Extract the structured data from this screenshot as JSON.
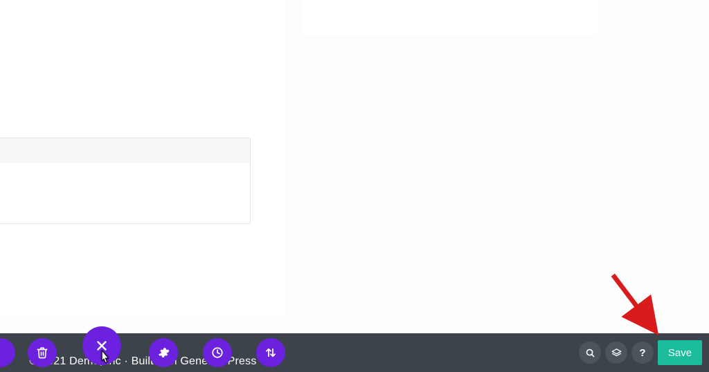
{
  "footer": {
    "text": "© 2021 Demo, Inc · Built with GeneratePress"
  },
  "toolbar": {
    "buttons": {
      "trash": "trash-icon",
      "close": "close-icon",
      "settings": "gear-icon",
      "history": "clock-icon",
      "sort": "sort-icon"
    },
    "right": {
      "search": "search-icon",
      "layers": "layers-icon",
      "help": "?"
    },
    "save_label": "Save"
  },
  "colors": {
    "accent": "#6b21dd",
    "save": "#1abc9c",
    "toolbar_bg": "#3c434a"
  }
}
